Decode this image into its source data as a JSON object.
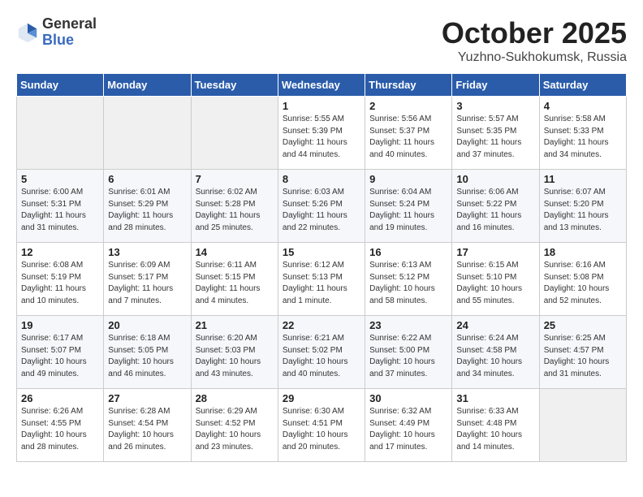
{
  "header": {
    "logo_general": "General",
    "logo_blue": "Blue",
    "title": "October 2025",
    "location": "Yuzhno-Sukhokumsk, Russia"
  },
  "weekdays": [
    "Sunday",
    "Monday",
    "Tuesday",
    "Wednesday",
    "Thursday",
    "Friday",
    "Saturday"
  ],
  "weeks": [
    [
      {
        "day": "",
        "info": ""
      },
      {
        "day": "",
        "info": ""
      },
      {
        "day": "",
        "info": ""
      },
      {
        "day": "1",
        "info": "Sunrise: 5:55 AM\nSunset: 5:39 PM\nDaylight: 11 hours and 44 minutes."
      },
      {
        "day": "2",
        "info": "Sunrise: 5:56 AM\nSunset: 5:37 PM\nDaylight: 11 hours and 40 minutes."
      },
      {
        "day": "3",
        "info": "Sunrise: 5:57 AM\nSunset: 5:35 PM\nDaylight: 11 hours and 37 minutes."
      },
      {
        "day": "4",
        "info": "Sunrise: 5:58 AM\nSunset: 5:33 PM\nDaylight: 11 hours and 34 minutes."
      }
    ],
    [
      {
        "day": "5",
        "info": "Sunrise: 6:00 AM\nSunset: 5:31 PM\nDaylight: 11 hours and 31 minutes."
      },
      {
        "day": "6",
        "info": "Sunrise: 6:01 AM\nSunset: 5:29 PM\nDaylight: 11 hours and 28 minutes."
      },
      {
        "day": "7",
        "info": "Sunrise: 6:02 AM\nSunset: 5:28 PM\nDaylight: 11 hours and 25 minutes."
      },
      {
        "day": "8",
        "info": "Sunrise: 6:03 AM\nSunset: 5:26 PM\nDaylight: 11 hours and 22 minutes."
      },
      {
        "day": "9",
        "info": "Sunrise: 6:04 AM\nSunset: 5:24 PM\nDaylight: 11 hours and 19 minutes."
      },
      {
        "day": "10",
        "info": "Sunrise: 6:06 AM\nSunset: 5:22 PM\nDaylight: 11 hours and 16 minutes."
      },
      {
        "day": "11",
        "info": "Sunrise: 6:07 AM\nSunset: 5:20 PM\nDaylight: 11 hours and 13 minutes."
      }
    ],
    [
      {
        "day": "12",
        "info": "Sunrise: 6:08 AM\nSunset: 5:19 PM\nDaylight: 11 hours and 10 minutes."
      },
      {
        "day": "13",
        "info": "Sunrise: 6:09 AM\nSunset: 5:17 PM\nDaylight: 11 hours and 7 minutes."
      },
      {
        "day": "14",
        "info": "Sunrise: 6:11 AM\nSunset: 5:15 PM\nDaylight: 11 hours and 4 minutes."
      },
      {
        "day": "15",
        "info": "Sunrise: 6:12 AM\nSunset: 5:13 PM\nDaylight: 11 hours and 1 minute."
      },
      {
        "day": "16",
        "info": "Sunrise: 6:13 AM\nSunset: 5:12 PM\nDaylight: 10 hours and 58 minutes."
      },
      {
        "day": "17",
        "info": "Sunrise: 6:15 AM\nSunset: 5:10 PM\nDaylight: 10 hours and 55 minutes."
      },
      {
        "day": "18",
        "info": "Sunrise: 6:16 AM\nSunset: 5:08 PM\nDaylight: 10 hours and 52 minutes."
      }
    ],
    [
      {
        "day": "19",
        "info": "Sunrise: 6:17 AM\nSunset: 5:07 PM\nDaylight: 10 hours and 49 minutes."
      },
      {
        "day": "20",
        "info": "Sunrise: 6:18 AM\nSunset: 5:05 PM\nDaylight: 10 hours and 46 minutes."
      },
      {
        "day": "21",
        "info": "Sunrise: 6:20 AM\nSunset: 5:03 PM\nDaylight: 10 hours and 43 minutes."
      },
      {
        "day": "22",
        "info": "Sunrise: 6:21 AM\nSunset: 5:02 PM\nDaylight: 10 hours and 40 minutes."
      },
      {
        "day": "23",
        "info": "Sunrise: 6:22 AM\nSunset: 5:00 PM\nDaylight: 10 hours and 37 minutes."
      },
      {
        "day": "24",
        "info": "Sunrise: 6:24 AM\nSunset: 4:58 PM\nDaylight: 10 hours and 34 minutes."
      },
      {
        "day": "25",
        "info": "Sunrise: 6:25 AM\nSunset: 4:57 PM\nDaylight: 10 hours and 31 minutes."
      }
    ],
    [
      {
        "day": "26",
        "info": "Sunrise: 6:26 AM\nSunset: 4:55 PM\nDaylight: 10 hours and 28 minutes."
      },
      {
        "day": "27",
        "info": "Sunrise: 6:28 AM\nSunset: 4:54 PM\nDaylight: 10 hours and 26 minutes."
      },
      {
        "day": "28",
        "info": "Sunrise: 6:29 AM\nSunset: 4:52 PM\nDaylight: 10 hours and 23 minutes."
      },
      {
        "day": "29",
        "info": "Sunrise: 6:30 AM\nSunset: 4:51 PM\nDaylight: 10 hours and 20 minutes."
      },
      {
        "day": "30",
        "info": "Sunrise: 6:32 AM\nSunset: 4:49 PM\nDaylight: 10 hours and 17 minutes."
      },
      {
        "day": "31",
        "info": "Sunrise: 6:33 AM\nSunset: 4:48 PM\nDaylight: 10 hours and 14 minutes."
      },
      {
        "day": "",
        "info": ""
      }
    ]
  ]
}
